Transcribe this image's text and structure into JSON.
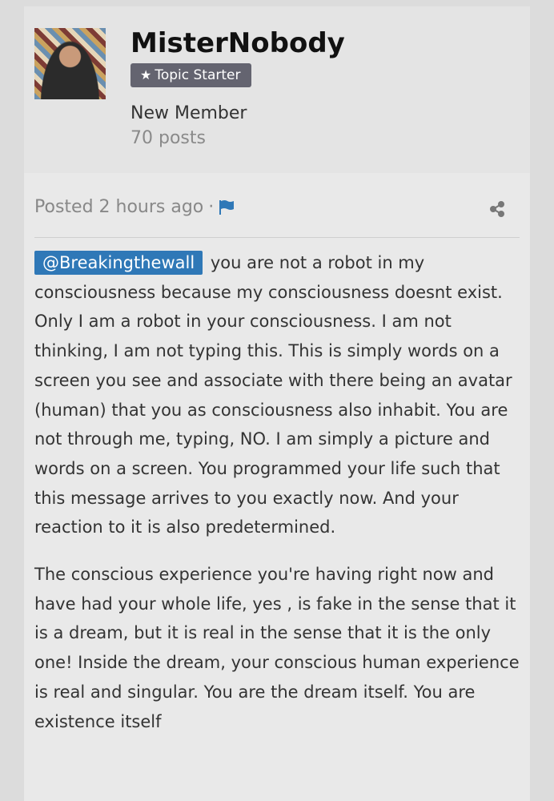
{
  "author": {
    "name": "MisterNobody",
    "badge": "Topic Starter",
    "rank": "New Member",
    "post_count": "70 posts"
  },
  "post": {
    "posted_label": "Posted 2 hours ago",
    "separator": "·",
    "mention": "@Breakingthewall",
    "paragraph1": "you are not a robot in my consciousness because my consciousness doesnt exist. Only I am a robot in your consciousness. I am not thinking, I am not typing this. This is simply words on a screen you see and associate with there being an avatar (human) that you as consciousness also inhabit. You are not through me, typing, NO. I am simply a picture and words on a screen. You programmed your life such that this message arrives to you exactly now. And your reaction to it is also predetermined.",
    "paragraph2": "The conscious experience you're having right now and have had your whole life, yes , is fake in the sense that it is a dream, but it is real in the sense that it is the only one! Inside the dream, your conscious human experience is real and singular. You are the dream itself. You are existence itself"
  },
  "icons": {
    "badge": "star-icon",
    "report": "flag-icon",
    "share": "share-icon"
  },
  "colors": {
    "mention_bg": "#2f78b7",
    "badge_bg": "#646470",
    "flag": "#2f78b7"
  }
}
